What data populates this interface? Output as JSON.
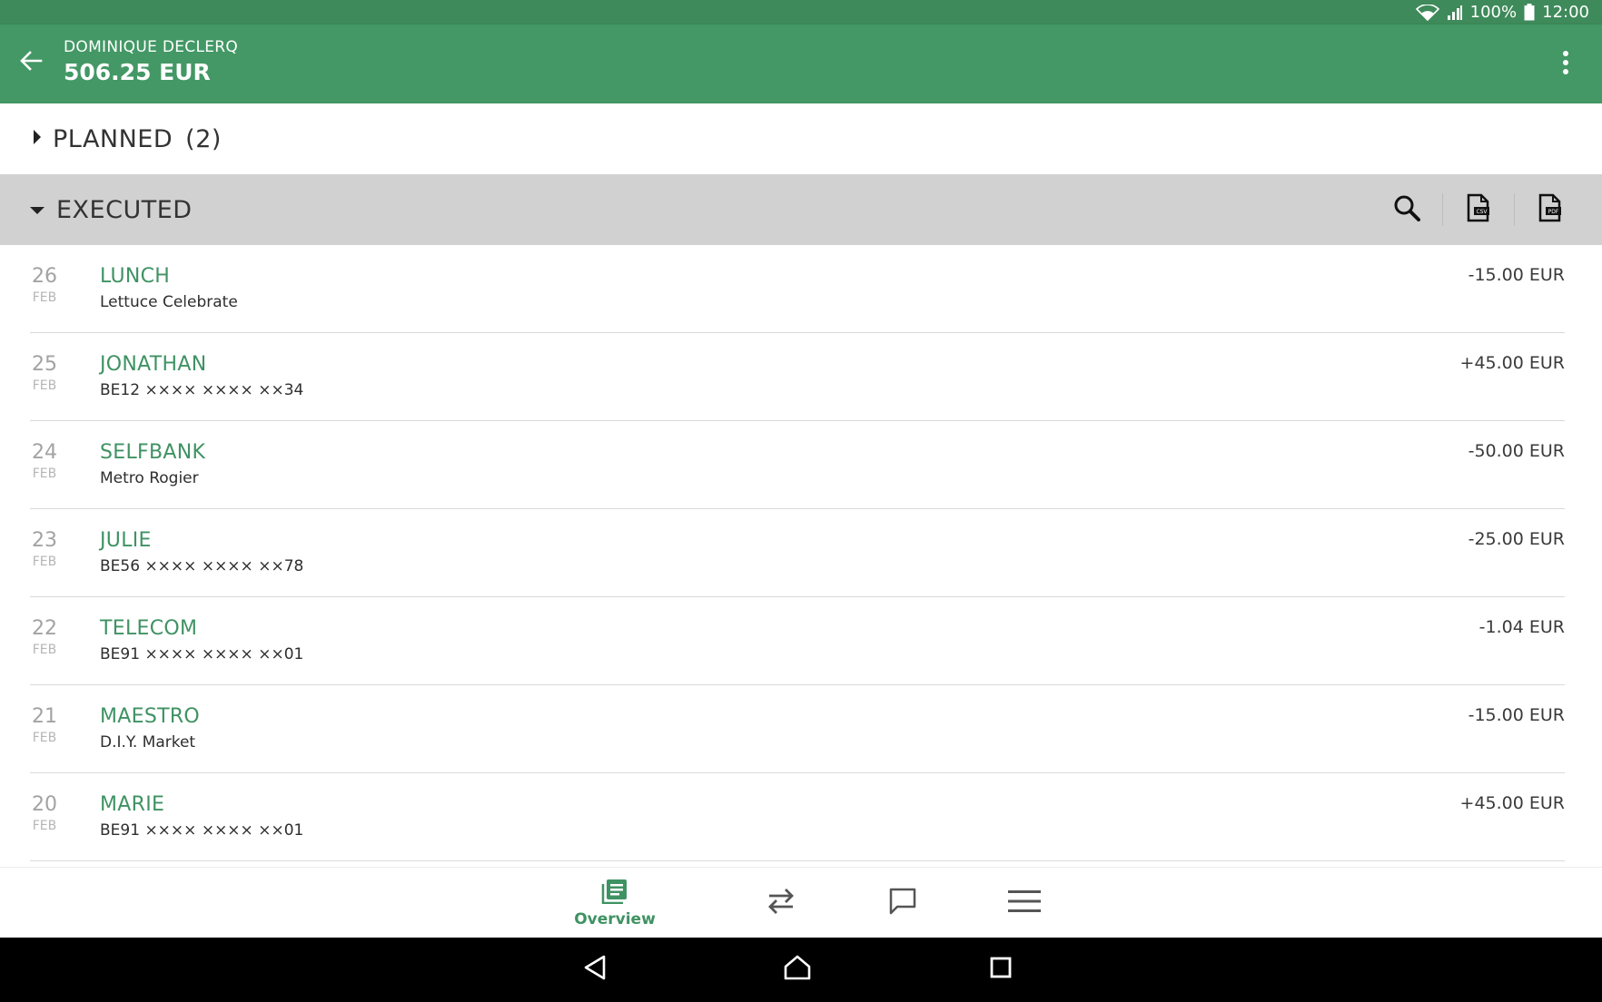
{
  "status_bar": {
    "battery": "100%",
    "time": "12:00"
  },
  "app_bar": {
    "account_name": "DOMINIQUE DECLERQ",
    "balance": "506.25 EUR"
  },
  "planned": {
    "label": "PLANNED",
    "count": "(2)"
  },
  "executed": {
    "label": "EXECUTED"
  },
  "transactions": [
    {
      "day": "26",
      "month": "FEB",
      "title": "LUNCH",
      "subtitle": "Lettuce Celebrate",
      "amount": "-15.00 EUR"
    },
    {
      "day": "25",
      "month": "FEB",
      "title": "JONATHAN",
      "subtitle": "BE12 ×××× ×××× ××34",
      "amount": "+45.00 EUR"
    },
    {
      "day": "24",
      "month": "FEB",
      "title": "SELFBANK",
      "subtitle": "Metro Rogier",
      "amount": "-50.00 EUR"
    },
    {
      "day": "23",
      "month": "FEB",
      "title": "JULIE",
      "subtitle": "BE56 ×××× ×××× ××78",
      "amount": "-25.00 EUR"
    },
    {
      "day": "22",
      "month": "FEB",
      "title": "TELECOM",
      "subtitle": "BE91 ×××× ×××× ××01",
      "amount": "-1.04 EUR"
    },
    {
      "day": "21",
      "month": "FEB",
      "title": "MAESTRO",
      "subtitle": "D.I.Y. Market",
      "amount": "-15.00 EUR"
    },
    {
      "day": "20",
      "month": "FEB",
      "title": "MARIE",
      "subtitle": "BE91 ×××× ×××× ××01",
      "amount": "+45.00 EUR"
    }
  ],
  "bottom_nav": {
    "overview_label": "Overview"
  },
  "colors": {
    "status_bar": "#3e8a5a",
    "app_bar": "#439865",
    "accent": "#3f9263",
    "executed_header": "#d1d1d1"
  },
  "icons": [
    "back-arrow-icon",
    "more-vert-icon",
    "caret-right-icon",
    "caret-down-icon",
    "search-icon",
    "csv-file-icon",
    "pdf-file-icon",
    "overview-icon",
    "transfer-icon",
    "message-icon",
    "menu-icon",
    "nav-back-icon",
    "nav-home-icon",
    "nav-recent-icon",
    "wifi-icon",
    "signal-icon",
    "battery-icon"
  ]
}
